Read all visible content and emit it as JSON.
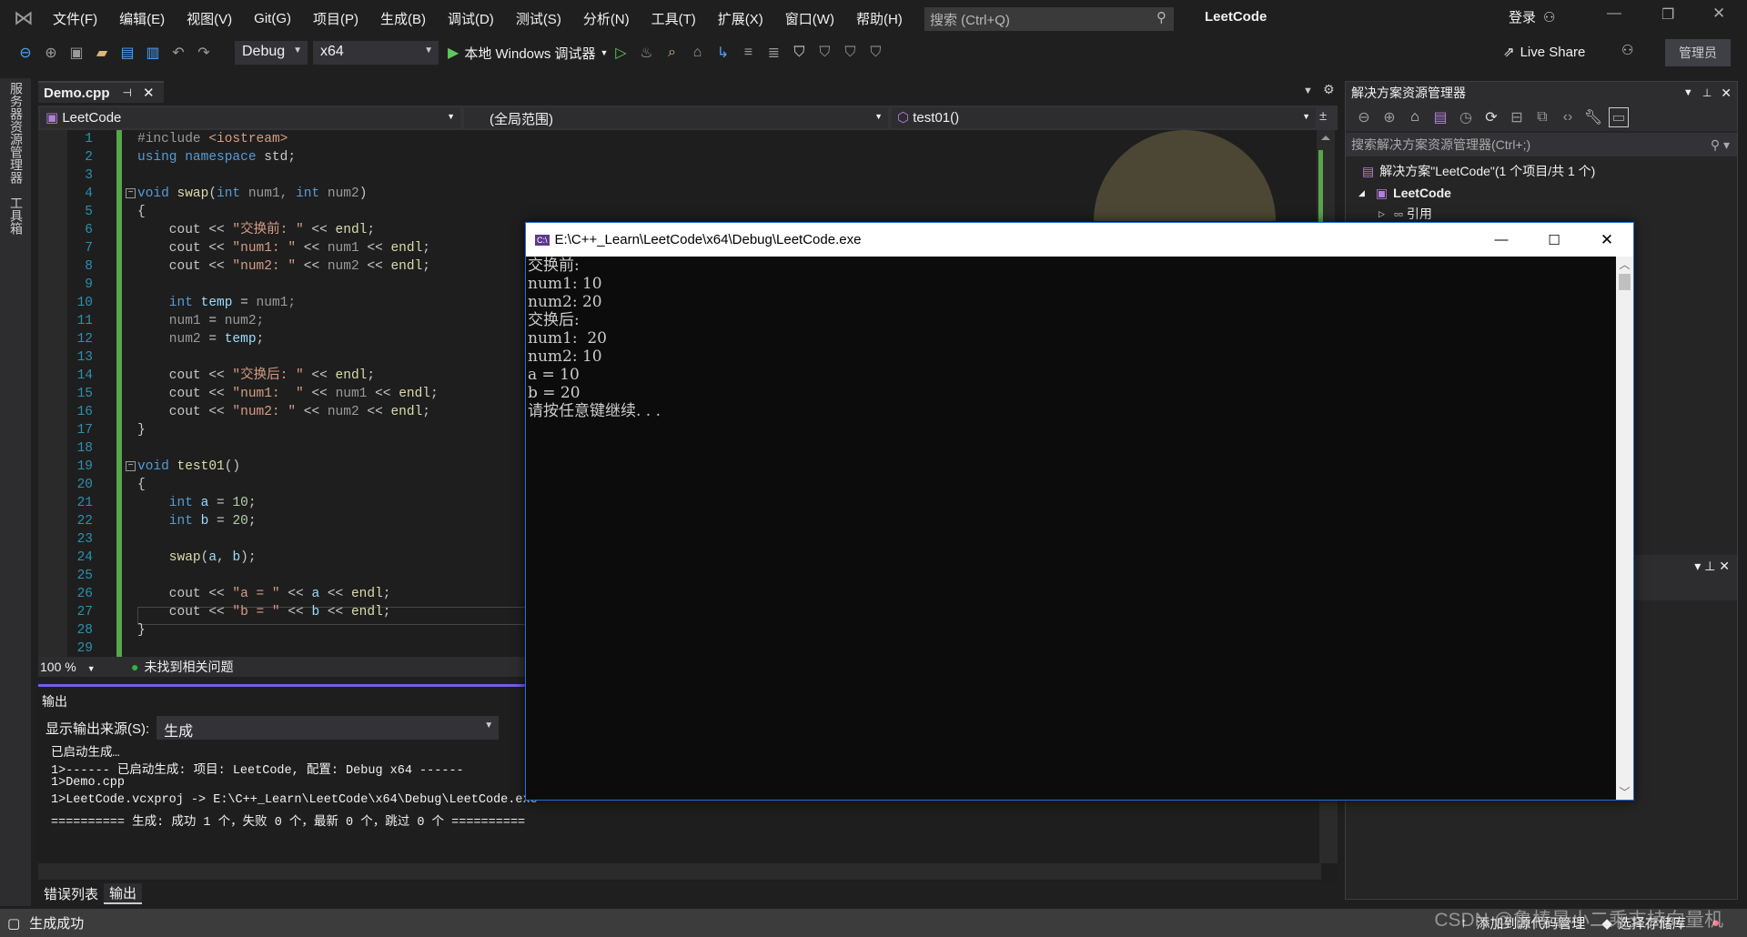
{
  "app": {
    "title": "LeetCode",
    "menus": [
      "文件(F)",
      "编辑(E)",
      "视图(V)",
      "Git(G)",
      "项目(P)",
      "生成(B)",
      "调试(D)",
      "测试(S)",
      "分析(N)",
      "工具(T)",
      "扩展(X)",
      "窗口(W)",
      "帮助(H)"
    ],
    "search_placeholder": "搜索 (Ctrl+Q)",
    "login": "登录",
    "accent": "#7160e8"
  },
  "toolbar": {
    "config": "Debug",
    "platform": "x64",
    "run_label": "本地 Windows 调试器",
    "live_share": "Live Share",
    "admin": "管理员"
  },
  "left_strip": [
    "服务器资源管理器",
    "工具箱"
  ],
  "editor": {
    "tab": "Demo.cpp",
    "nav_project": "LeetCode",
    "nav_scope": "(全局范围)",
    "nav_member": "test01()",
    "zoom": "100 %",
    "issues": "未找到相关问题",
    "lines": [
      [
        [
          "pp",
          "#include "
        ],
        [
          "st",
          "<iostream>"
        ]
      ],
      [
        [
          "kw",
          "using namespace "
        ],
        [
          "id",
          "std;"
        ]
      ],
      [],
      [
        [
          "kw",
          "void "
        ],
        [
          "fn",
          "swap"
        ],
        [
          "id",
          "("
        ],
        [
          "kw",
          "int "
        ],
        [
          "pa",
          "num1, "
        ],
        [
          "kw",
          "int "
        ],
        [
          "pa",
          "num2"
        ],
        [
          "id",
          ")"
        ]
      ],
      [
        [
          "id",
          "{"
        ]
      ],
      [
        [
          "id",
          "    cout << "
        ],
        [
          "st",
          "\"交换前: \""
        ],
        [
          "id",
          " << "
        ],
        [
          "fn",
          "endl"
        ],
        [
          "id",
          ";"
        ]
      ],
      [
        [
          "id",
          "    cout << "
        ],
        [
          "st",
          "\"num1: \""
        ],
        [
          "id",
          " << "
        ],
        [
          "pa",
          "num1"
        ],
        [
          "id",
          " << "
        ],
        [
          "fn",
          "endl"
        ],
        [
          "id",
          ";"
        ]
      ],
      [
        [
          "id",
          "    cout << "
        ],
        [
          "st",
          "\"num2: \""
        ],
        [
          "id",
          " << "
        ],
        [
          "pa",
          "num2"
        ],
        [
          "id",
          " << "
        ],
        [
          "fn",
          "endl"
        ],
        [
          "id",
          ";"
        ]
      ],
      [],
      [
        [
          "kw",
          "    int "
        ],
        [
          "va",
          "temp"
        ],
        [
          "id",
          " = "
        ],
        [
          "pa",
          "num1;"
        ]
      ],
      [
        [
          "pa",
          "    num1"
        ],
        [
          "id",
          " = "
        ],
        [
          "pa",
          "num2;"
        ]
      ],
      [
        [
          "pa",
          "    num2"
        ],
        [
          "id",
          " = "
        ],
        [
          "va",
          "temp"
        ],
        [
          "id",
          ";"
        ]
      ],
      [],
      [
        [
          "id",
          "    cout << "
        ],
        [
          "st",
          "\"交换后: \""
        ],
        [
          "id",
          " << "
        ],
        [
          "fn",
          "endl"
        ],
        [
          "id",
          ";"
        ]
      ],
      [
        [
          "id",
          "    cout << "
        ],
        [
          "st",
          "\"num1:  \""
        ],
        [
          "id",
          " << "
        ],
        [
          "pa",
          "num1"
        ],
        [
          "id",
          " << "
        ],
        [
          "fn",
          "endl"
        ],
        [
          "id",
          ";"
        ]
      ],
      [
        [
          "id",
          "    cout << "
        ],
        [
          "st",
          "\"num2: \""
        ],
        [
          "id",
          " << "
        ],
        [
          "pa",
          "num2"
        ],
        [
          "id",
          " << "
        ],
        [
          "fn",
          "endl"
        ],
        [
          "id",
          ";"
        ]
      ],
      [
        [
          "id",
          "}"
        ]
      ],
      [],
      [
        [
          "kw",
          "void "
        ],
        [
          "fn",
          "test01"
        ],
        [
          "id",
          "()"
        ]
      ],
      [
        [
          "id",
          "{"
        ]
      ],
      [
        [
          "kw",
          "    int "
        ],
        [
          "va",
          "a"
        ],
        [
          "id",
          " = "
        ],
        [
          "nu",
          "10"
        ],
        [
          "id",
          ";"
        ]
      ],
      [
        [
          "kw",
          "    int "
        ],
        [
          "va",
          "b"
        ],
        [
          "id",
          " = "
        ],
        [
          "nu",
          "20"
        ],
        [
          "id",
          ";"
        ]
      ],
      [],
      [
        [
          "fn",
          "    swap"
        ],
        [
          "id",
          "("
        ],
        [
          "va",
          "a"
        ],
        [
          "id",
          ", "
        ],
        [
          "va",
          "b"
        ],
        [
          "id",
          ");"
        ]
      ],
      [],
      [
        [
          "id",
          "    cout << "
        ],
        [
          "st",
          "\"a = \""
        ],
        [
          "id",
          " << "
        ],
        [
          "va",
          "a"
        ],
        [
          "id",
          " << "
        ],
        [
          "fn",
          "endl"
        ],
        [
          "id",
          ";"
        ]
      ],
      [
        [
          "id",
          "    cout << "
        ],
        [
          "st",
          "\"b = \""
        ],
        [
          "id",
          " << "
        ],
        [
          "va",
          "b"
        ],
        [
          "id",
          " << "
        ],
        [
          "fn",
          "endl"
        ],
        [
          "id",
          ";"
        ]
      ],
      [
        [
          "id",
          "}"
        ]
      ],
      []
    ]
  },
  "output": {
    "title": "输出",
    "source_label": "显示输出来源(S):",
    "source_value": "生成",
    "lines": [
      "已启动生成…",
      "1>------ 已启动生成: 项目: LeetCode, 配置: Debug x64 ------",
      "1>Demo.cpp",
      "1>LeetCode.vcxproj -> E:\\C++_Learn\\LeetCode\\x64\\Debug\\LeetCode.exe",
      "========== 生成: 成功 1 个，失败 0 个，最新 0 个，跳过 0 个 =========="
    ],
    "tabs": [
      "错误列表",
      "输出"
    ]
  },
  "solution": {
    "title": "解决方案资源管理器",
    "search_placeholder": "搜索解决方案资源管理器(Ctrl+;)",
    "items": [
      "解决方案\"LeetCode\"(1 个项目/共 1 个)",
      "LeetCode",
      "引用"
    ]
  },
  "console": {
    "title": "E:\\C++_Learn\\LeetCode\\x64\\Debug\\LeetCode.exe",
    "lines": [
      "交换前:",
      "num1: 10",
      "num2: 20",
      "交换后:",
      "num1:  20",
      "num2: 10",
      "a = 10",
      "b = 20",
      "请按任意键继续. . ."
    ]
  },
  "status": {
    "left": "生成成功",
    "add_source": "添加到源代码管理",
    "select_repo": "选择存储库",
    "watermark": "CSDN @鲁棒最小二乘支持向量机"
  }
}
